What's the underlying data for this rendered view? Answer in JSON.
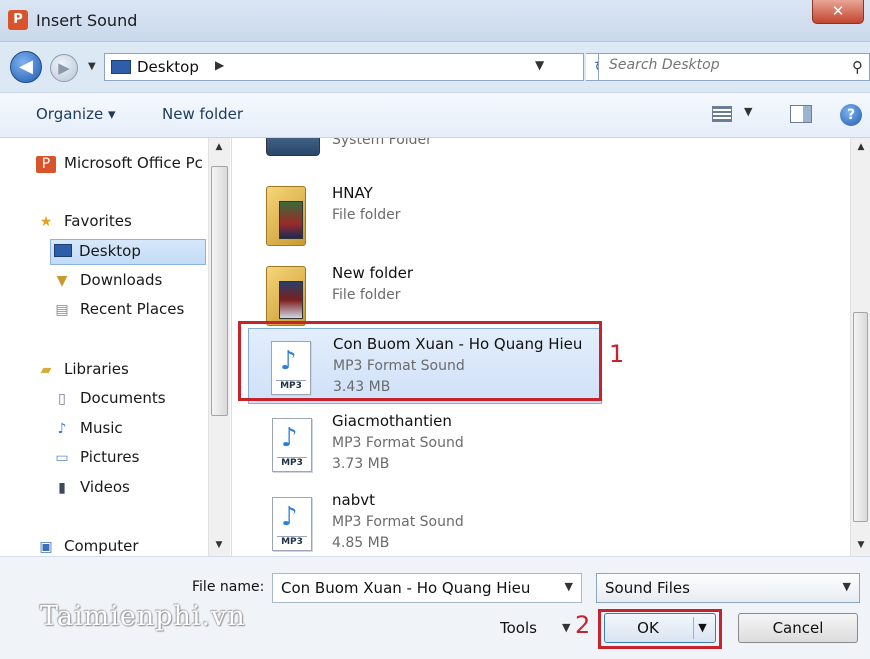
{
  "window": {
    "title": "Insert Sound",
    "close_glyph": "✕"
  },
  "nav": {
    "back_glyph": "◀",
    "forward_glyph": "▶",
    "recent_glyph": "▼",
    "address": "Desktop",
    "address_arrow": "▶",
    "address_drop": "▼",
    "refresh_glyph": "↻",
    "search_placeholder": "Search Desktop",
    "search_glyph": "⚲"
  },
  "toolbar": {
    "organize": "Organize ▾",
    "new_folder": "New folder",
    "views_drop": "▼",
    "help_glyph": "?"
  },
  "sidebar": {
    "office": "Microsoft Office Pc",
    "favorites": "Favorites",
    "desktop": "Desktop",
    "downloads": "Downloads",
    "recent_places": "Recent Places",
    "libraries": "Libraries",
    "documents": "Documents",
    "music": "Music",
    "pictures": "Pictures",
    "videos": "Videos",
    "computer": "Computer",
    "scroll_up": "▲",
    "scroll_down": "▼"
  },
  "files": [
    {
      "name": "",
      "type": "System Folder",
      "size": ""
    },
    {
      "name": "HNAY",
      "type": "File folder",
      "size": ""
    },
    {
      "name": "New folder",
      "type": "File folder",
      "size": ""
    },
    {
      "name": "Con Buom Xuan - Ho Quang Hieu",
      "type": "MP3 Format Sound",
      "size": "3.43 MB"
    },
    {
      "name": "Giacmothantien",
      "type": "MP3 Format Sound",
      "size": "3.73 MB"
    },
    {
      "name": "nabvt",
      "type": "MP3 Format Sound",
      "size": "4.85 MB"
    }
  ],
  "mp3_tag": "MP3",
  "note_glyph": "♪",
  "annotations": {
    "one": "1",
    "two": "2"
  },
  "footer": {
    "file_name_label": "File name:",
    "file_name_value": "Con Buom Xuan - Ho Quang Hieu",
    "file_name_drop": "▼",
    "file_type": "Sound Files",
    "file_type_drop": "▼",
    "tools": "Tools",
    "tools_drop": "▼",
    "ok": "OK",
    "ok_split": "▼",
    "cancel": "Cancel"
  },
  "watermark": "Taimienphi.vn"
}
